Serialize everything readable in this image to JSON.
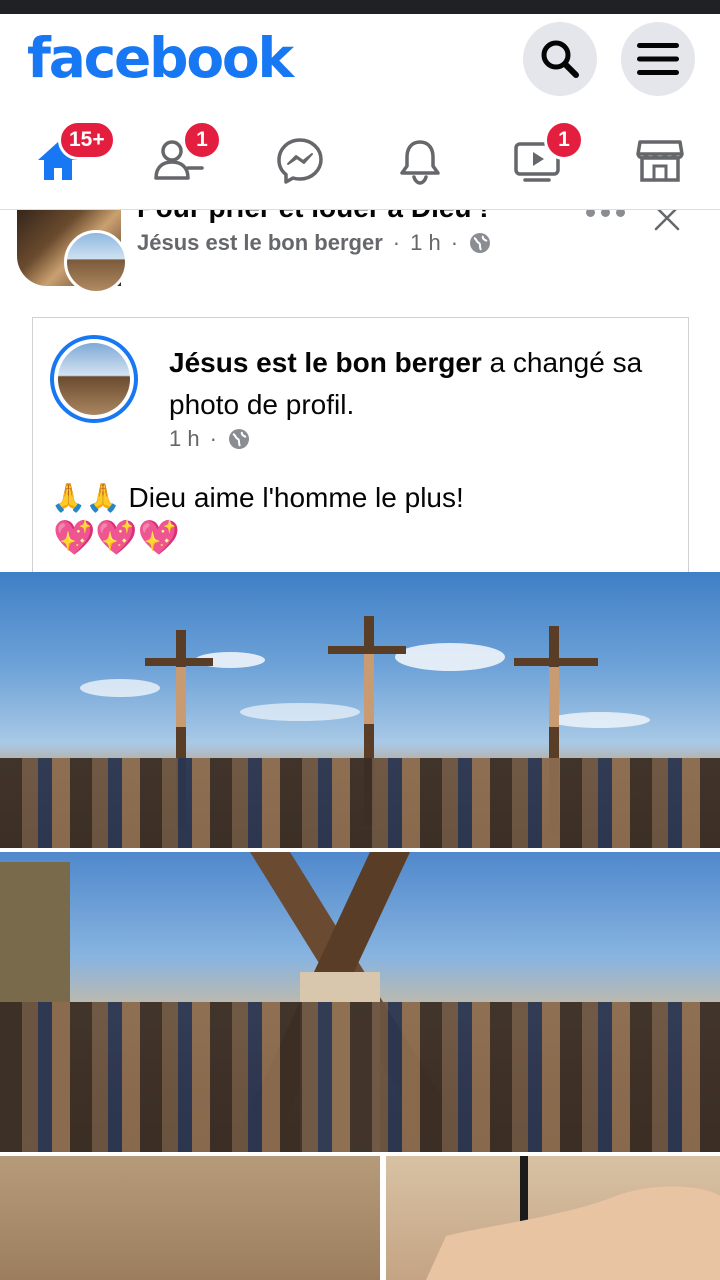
{
  "app": {
    "logo_text": "facebook",
    "brand_color": "#1877f2",
    "badge_color": "#e41e3f"
  },
  "header": {
    "search_icon": "search-icon",
    "menu_icon": "hamburger-menu-icon"
  },
  "nav": {
    "tabs": [
      {
        "name": "home",
        "icon": "home-icon",
        "badge": "15+",
        "active": true
      },
      {
        "name": "friends",
        "icon": "friends-icon",
        "badge": "1"
      },
      {
        "name": "messenger",
        "icon": "messenger-icon",
        "badge": ""
      },
      {
        "name": "notifications",
        "icon": "bell-icon",
        "badge": ""
      },
      {
        "name": "watch",
        "icon": "video-icon",
        "badge": "1"
      },
      {
        "name": "marketplace",
        "icon": "marketplace-icon",
        "badge": ""
      }
    ]
  },
  "post": {
    "title": "Pour prier et louer à Dieu !",
    "page_name": "Jésus est le bon berger",
    "time": "1 h",
    "shared": {
      "author": "Jésus est le bon berger",
      "action": " a changé sa photo de profil.",
      "time": "1 h",
      "body_text": "Dieu aime l'homme le plus!",
      "emoji_prefix": "🙏🙏",
      "emoji_line": "💖💖💖"
    }
  }
}
